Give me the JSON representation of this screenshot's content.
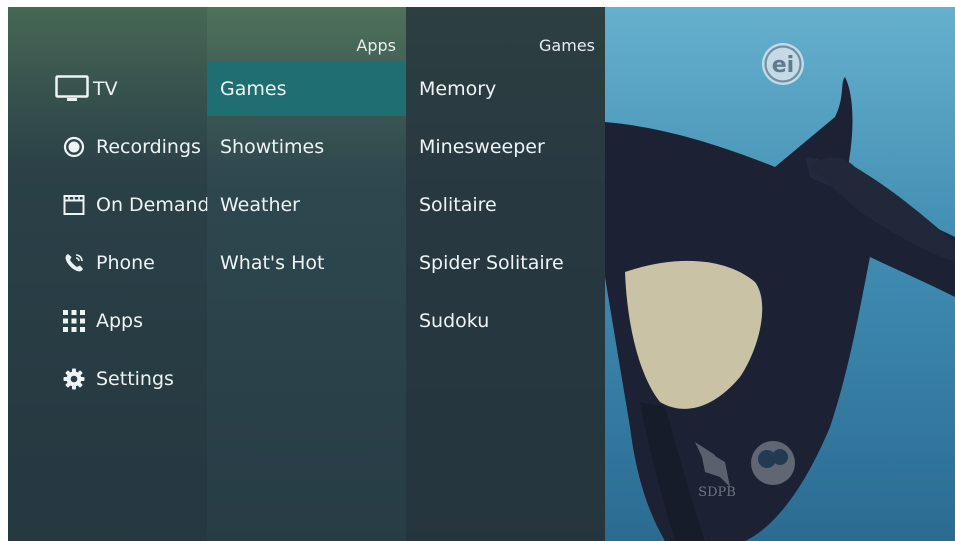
{
  "nav": {
    "items": [
      {
        "label": "TV",
        "icon": "tv-icon"
      },
      {
        "label": "Recordings",
        "icon": "record-icon"
      },
      {
        "label": "On Demand",
        "icon": "clapperboard-icon"
      },
      {
        "label": "Phone",
        "icon": "phone-icon"
      },
      {
        "label": "Apps",
        "icon": "grid-icon"
      },
      {
        "label": "Settings",
        "icon": "gear-icon"
      }
    ]
  },
  "apps": {
    "header": "Apps",
    "selected": "Games",
    "items": [
      "Games",
      "Showtimes",
      "Weather",
      "What's Hot"
    ]
  },
  "games": {
    "header": "Games",
    "items": [
      "Memory",
      "Minesweeper",
      "Solitaire",
      "Spider Solitaire",
      "Sudoku"
    ]
  },
  "video": {
    "rating_badge": "ei",
    "watermark": "SDPB",
    "colors": {
      "water": "#3f8fb0",
      "whale_dark": "#1c2233",
      "whale_light": "#c9c2a4"
    }
  },
  "colors": {
    "selected": "#1f6f72",
    "text": "#eef3f4"
  }
}
